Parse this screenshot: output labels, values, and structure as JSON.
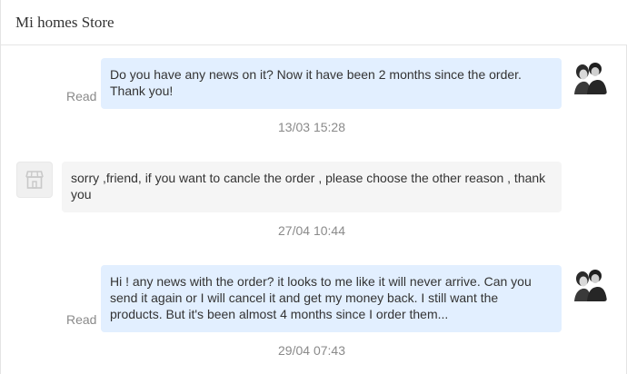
{
  "header": {
    "store_name": "Mi homes Store"
  },
  "messages": [
    {
      "sender": "user",
      "text": "Do you have any news on it? Now it have been 2 months since the order. Thank you!",
      "status": "Read",
      "time": "13/03 15:28"
    },
    {
      "sender": "store",
      "text": "sorry ,friend, if you want to cancle the order ,  please  choose the other reason , thank you",
      "time": "27/04 10:44"
    },
    {
      "sender": "user",
      "text": "Hi ! any news with the order? it looks to me like it will never arrive. Can you send it again or I will cancel it and get my money back. I still want the products. But it's been almost 4 months since I order them...",
      "status": "Read",
      "time": "29/04 07:43"
    }
  ],
  "colors": {
    "outgoing_bubble": "#e2efff",
    "incoming_bubble": "#f5f5f5",
    "muted_text": "#8a8a8a"
  },
  "icons": {
    "user_avatar": "user-avatar-photo",
    "store_avatar": "storefront-icon"
  }
}
